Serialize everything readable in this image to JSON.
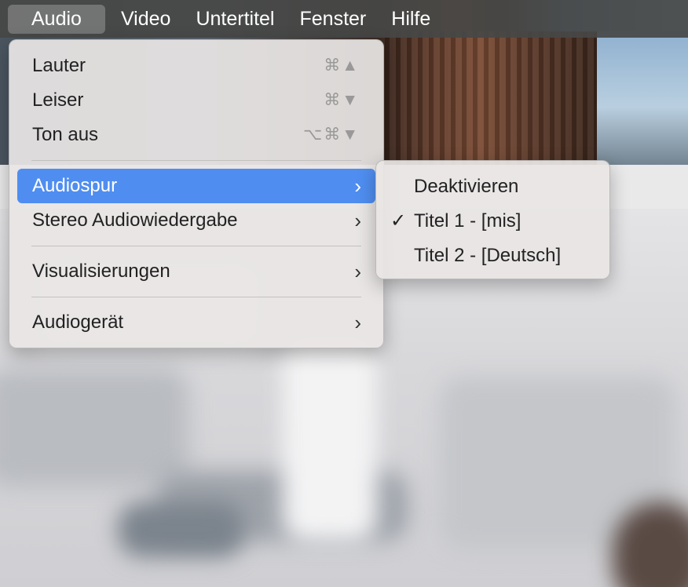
{
  "menubar": {
    "items": [
      {
        "label": "Audio",
        "active": true
      },
      {
        "label": "Video",
        "active": false
      },
      {
        "label": "Untertitel",
        "active": false
      },
      {
        "label": "Fenster",
        "active": false
      },
      {
        "label": "Hilfe",
        "active": false
      }
    ]
  },
  "audio_menu": {
    "items": [
      {
        "label": "Lauter",
        "shortcut": "⌘▲"
      },
      {
        "label": "Leiser",
        "shortcut": "⌘▼"
      },
      {
        "label": "Ton aus",
        "shortcut": "⌥⌘▼"
      },
      {
        "label": "Audiospur",
        "submenu": true,
        "highlighted": true
      },
      {
        "label": "Stereo Audiowiedergabe",
        "submenu": true
      },
      {
        "label": "Visualisierungen",
        "submenu": true
      },
      {
        "label": "Audiogerät",
        "submenu": true
      }
    ],
    "chevron": "›"
  },
  "audiospur_submenu": {
    "items": [
      {
        "label": "Deaktivieren",
        "checked": false
      },
      {
        "label": "Titel 1 - [mis]",
        "checked": true
      },
      {
        "label": "Titel 2 - [Deutsch]",
        "checked": false
      }
    ],
    "check_glyph": "✓"
  },
  "colors": {
    "highlight": "#4f8ef0",
    "menubar_bg": "#464846",
    "menu_bg": "#e8e5e4"
  },
  "icons": {
    "check": "checkmark-icon",
    "submenu": "chevron-right-icon"
  }
}
